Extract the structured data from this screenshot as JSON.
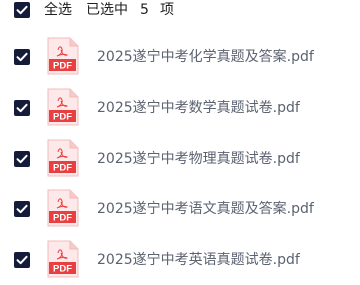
{
  "header": {
    "select_all_label": "全选",
    "selected_text": "已选中",
    "selected_count": "5",
    "selected_unit": "项"
  },
  "files": [
    {
      "name": "2025遂宁中考化学真题及答案.pdf",
      "checked": true,
      "icon_label": "PDF"
    },
    {
      "name": "2025遂宁中考数学真题试卷.pdf",
      "checked": true,
      "icon_label": "PDF"
    },
    {
      "name": "2025遂宁中考物理真题试卷.pdf",
      "checked": true,
      "icon_label": "PDF"
    },
    {
      "name": "2025遂宁中考语文真题及答案.pdf",
      "checked": true,
      "icon_label": "PDF"
    },
    {
      "name": "2025遂宁中考英语真题试卷.pdf",
      "checked": true,
      "icon_label": "PDF"
    }
  ],
  "colors": {
    "checkbox": "#151c3a",
    "pdf_red": "#e84040",
    "pdf_bg": "#fde9e9",
    "file_text": "#5b6270"
  }
}
